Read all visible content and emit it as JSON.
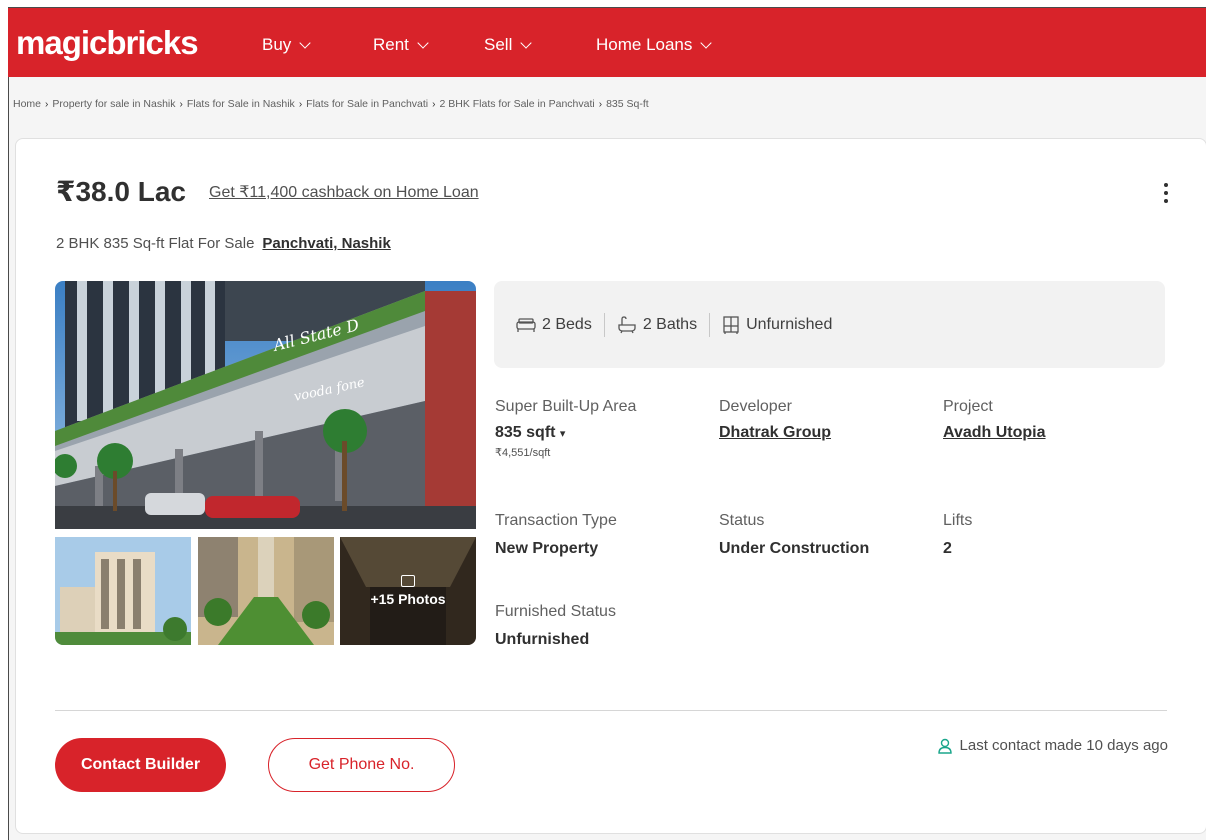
{
  "header": {
    "logo": "magicbricks",
    "nav": [
      {
        "label": "Buy"
      },
      {
        "label": "Rent"
      },
      {
        "label": "Sell"
      },
      {
        "label": "Home Loans"
      }
    ]
  },
  "breadcrumb": [
    "Home",
    "Property for sale in Nashik",
    "Flats for Sale in Nashik",
    "Flats for Sale in Panchvati",
    "2 BHK Flats for Sale in Panchvati",
    "835 Sq-ft"
  ],
  "listing": {
    "price": "₹38.0 Lac",
    "cashback": "Get ₹11,400 cashback on Home Loan",
    "title": "2 BHK 835 Sq-ft Flat For Sale",
    "location": "Panchvati, Nashik",
    "photos_more": "+15 Photos",
    "summary": {
      "beds": "2 Beds",
      "baths": "2 Baths",
      "furnishing": "Unfurnished"
    },
    "details": {
      "area_label": "Super Built-Up Area",
      "area_value": "835 sqft",
      "area_rate": "₹4,551/sqft",
      "developer_label": "Developer",
      "developer_value": "Dhatrak Group",
      "project_label": "Project",
      "project_value": "Avadh Utopia",
      "transaction_label": "Transaction Type",
      "transaction_value": "New Property",
      "status_label": "Status",
      "status_value": "Under Construction",
      "lifts_label": "Lifts",
      "lifts_value": "2",
      "furnished_label": "Furnished Status",
      "furnished_value": "Unfurnished"
    },
    "actions": {
      "contact_builder": "Contact Builder",
      "get_phone": "Get Phone No."
    },
    "last_contact": "Last contact made 10 days ago"
  },
  "colors": {
    "brand_red": "#d8232a",
    "teal_icon": "#1aa68b"
  }
}
